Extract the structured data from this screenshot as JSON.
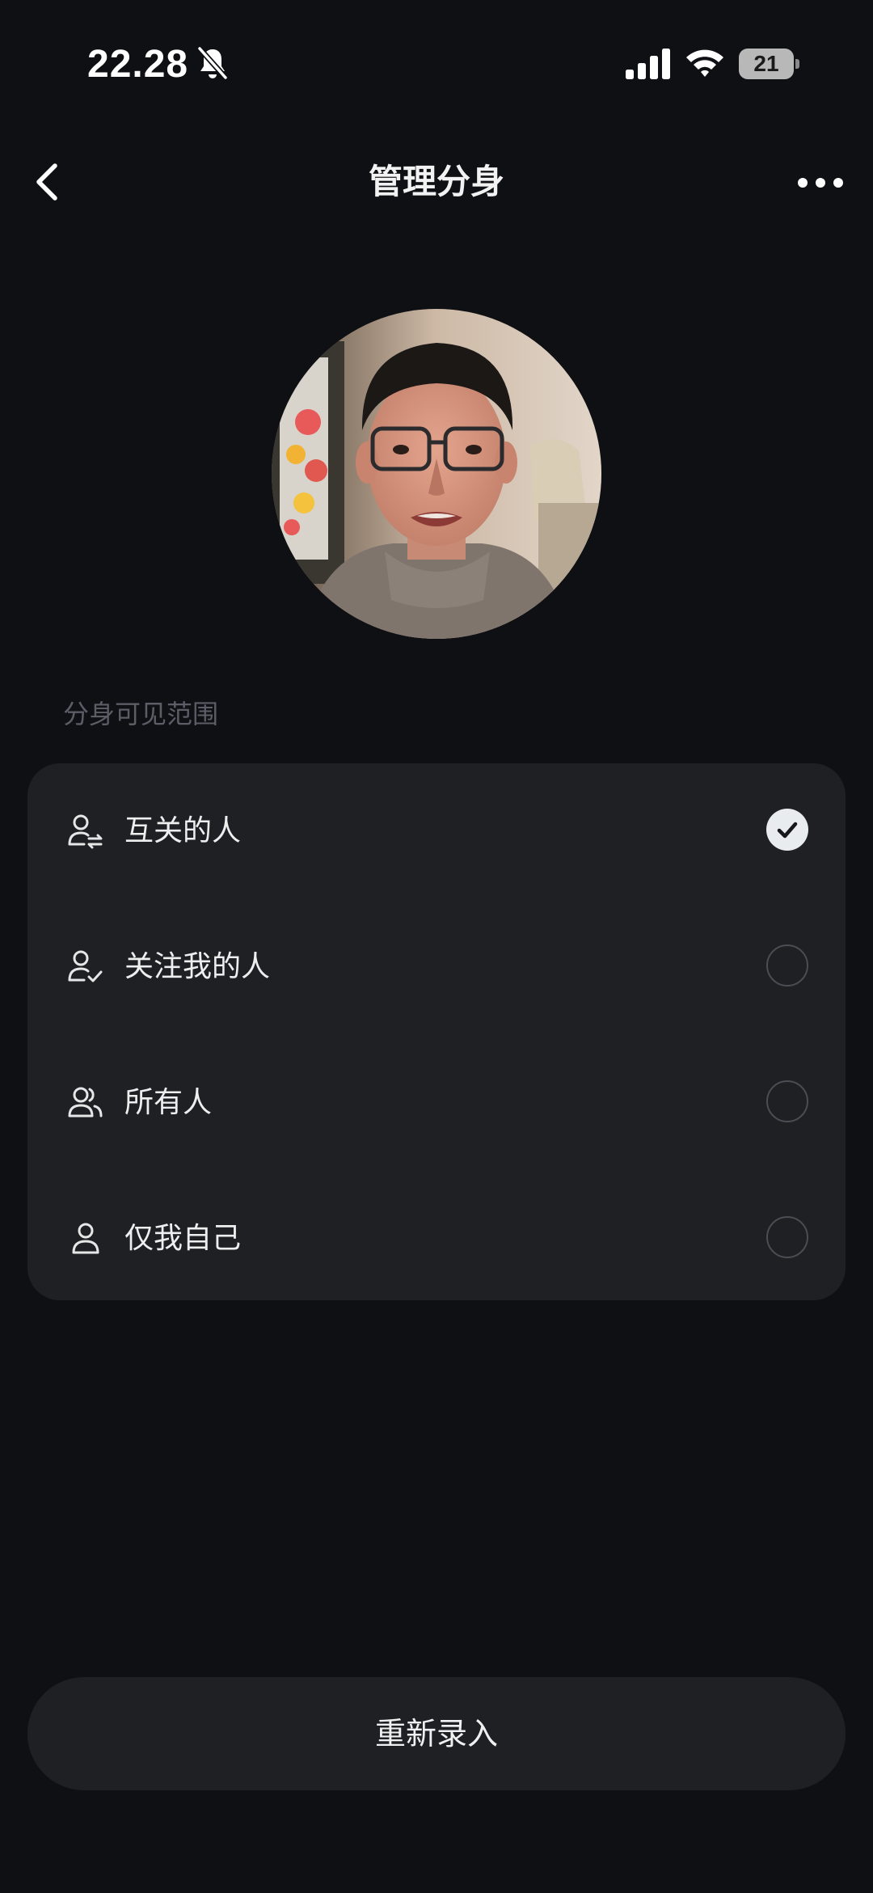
{
  "status_bar": {
    "time": "22.28",
    "battery_level": "21",
    "icons": [
      "bell-muted-icon",
      "cellular-signal-icon",
      "wifi-icon",
      "battery-icon"
    ]
  },
  "nav": {
    "title": "管理分身",
    "back_icon": "chevron-left-icon",
    "more_icon": "more-dots-icon"
  },
  "section_label": "分身可见范围",
  "options": [
    {
      "label": "互关的人",
      "icon": "mutual-follow-user-icon",
      "selected": true
    },
    {
      "label": "关注我的人",
      "icon": "follower-user-check-icon",
      "selected": false
    },
    {
      "label": "所有人",
      "icon": "users-group-icon",
      "selected": false
    },
    {
      "label": "仅我自己",
      "icon": "single-user-icon",
      "selected": false
    }
  ],
  "rerecord_button_label": "重新录入",
  "colors": {
    "background": "#0f1014",
    "card": "#1e2024",
    "section_label": "#5b5e66",
    "radio_checked": "#e9ecef"
  }
}
